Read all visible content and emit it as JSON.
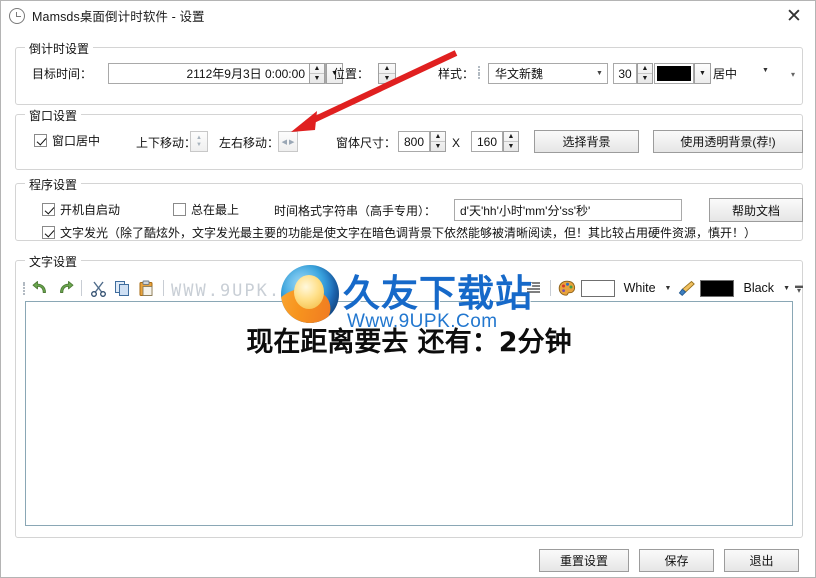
{
  "window": {
    "title": "Mamsds桌面倒计时软件 - 设置",
    "title_icon": "clock-icon",
    "close_label": "✕"
  },
  "countdown_group": {
    "legend": "倒计时设置",
    "target_time_label": "目标时间：",
    "target_time_value": "2112年9月3日 0:00:00",
    "position_label": "位置：",
    "style_label": "样式：",
    "font_family_value": "华文新魏",
    "font_size_value": "30",
    "font_color": "#000000",
    "align_value": "居中"
  },
  "window_group": {
    "legend": "窗口设置",
    "center_checkbox_label": "窗口居中",
    "center_checked": true,
    "vertical_move_label": "上下移动：",
    "horizontal_move_label": "左右移动：",
    "size_label": "窗体尺寸：",
    "width_value": "800",
    "size_sep": "X",
    "height_value": "160",
    "choose_bg_button": "选择背景",
    "transparent_bg_button": "使用透明背景(荐!)"
  },
  "program_group": {
    "legend": "程序设置",
    "autostart_label": "开机自启动",
    "autostart_checked": true,
    "always_on_top_label": "总在最上",
    "always_on_top_checked": false,
    "time_format_label": "时间格式字符串（高手专用）：",
    "time_format_value": "d'天'hh'小时'mm'分'ss'秒'",
    "help_button": "帮助文档",
    "glow_label": "文字发光（除了酷炫外，文字发光最主要的功能是使文字在暗色调背景下依然能够被清晰阅读，但！其比较占用硬件资源，慎开！）",
    "glow_checked": true
  },
  "text_group": {
    "legend": "文字设置",
    "toolbar": {
      "undo": "undo-icon",
      "redo": "redo-icon",
      "cut": "cut-icon",
      "copy": "copy-icon",
      "paste": "paste-icon",
      "align": "align-icon",
      "palette": "palette-icon",
      "fill_color": "#ffffff",
      "fill_label": "White",
      "brush": "brush-icon",
      "outline_color": "#000000",
      "outline_label": "Black"
    },
    "preview_text": "现在距离要去 还有：2分钟"
  },
  "watermark": {
    "faint_text": "WWW.9UPK.COM",
    "site_name": "久友下载站",
    "site_url": "Www.9UPK.Com"
  },
  "footer": {
    "reset_button": "重置设置",
    "save_button": "保存",
    "exit_button": "退出"
  }
}
